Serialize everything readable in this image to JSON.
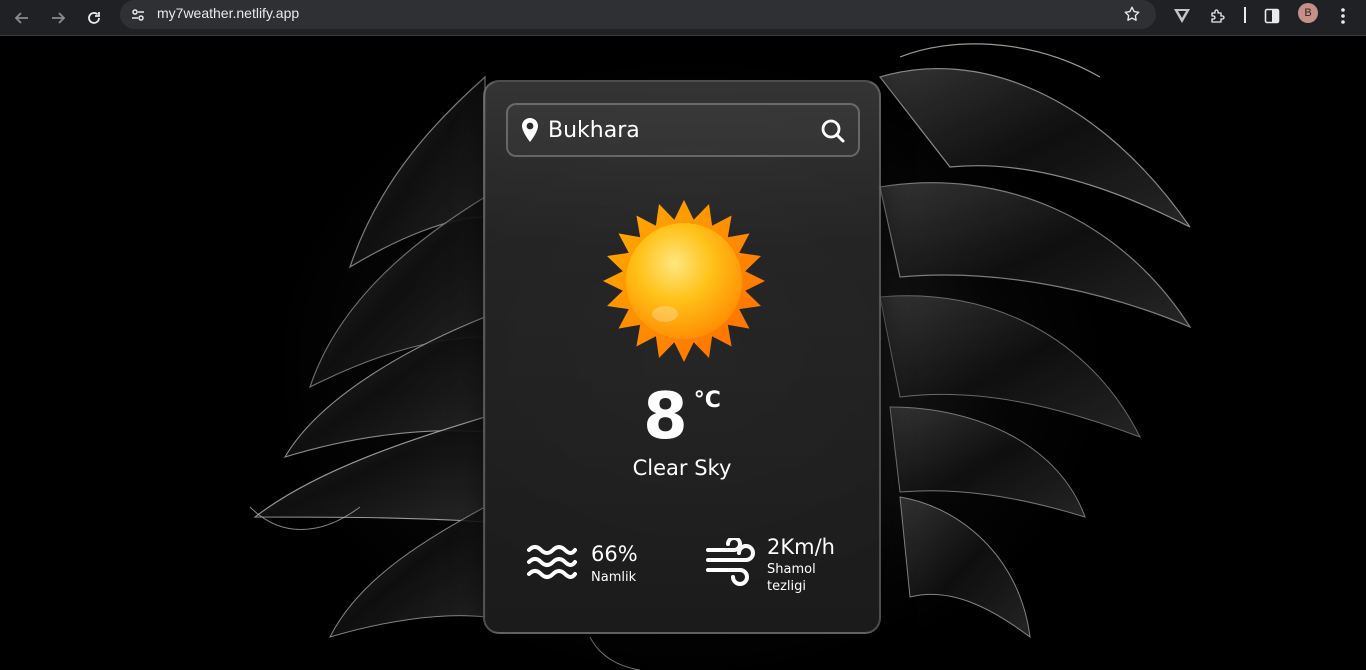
{
  "browser": {
    "url": "my7weather.netlify.app",
    "profile_initial": "B"
  },
  "weather": {
    "search": {
      "value": "Bukhara",
      "placeholder": ""
    },
    "temperature": "8",
    "unit": "°C",
    "condition": "Clear Sky",
    "humidity": {
      "value": "66%",
      "label": "Namlik"
    },
    "wind": {
      "value": "2Km/h",
      "label_line1": "Shamol",
      "label_line2": "tezligi"
    }
  },
  "icons": {
    "condition_icon": "sun-icon",
    "humidity_icon": "waves-icon",
    "wind_icon": "wind-icon"
  }
}
